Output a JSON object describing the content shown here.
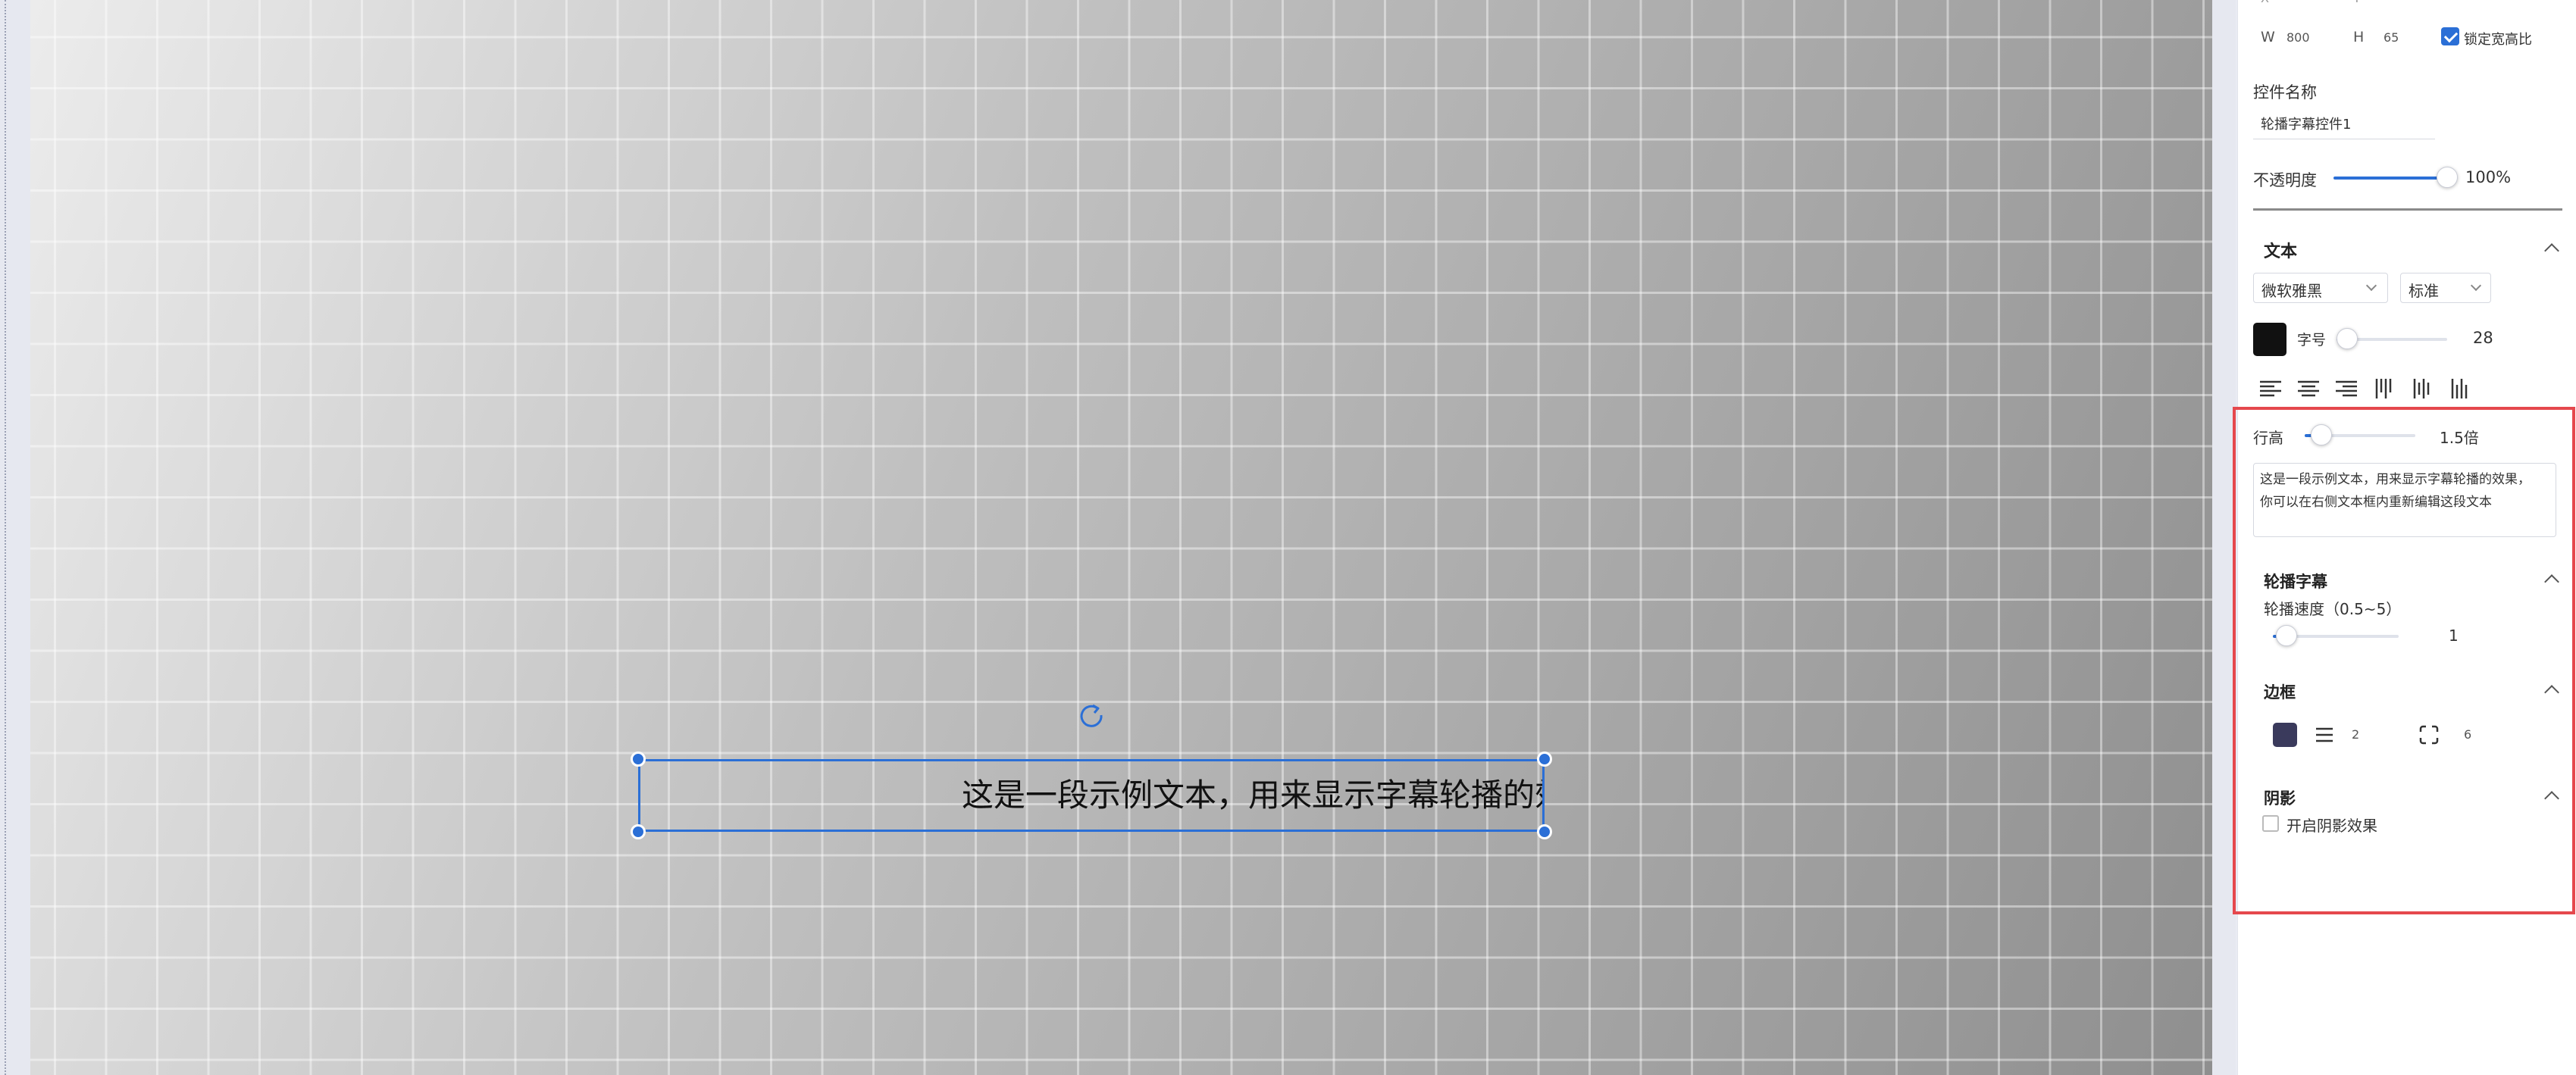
{
  "canvas": {
    "marquee_text": "这是一段示例文本，用来显示字幕轮播的效果，你可以在右侧文本框内重新编辑这段文本"
  },
  "panel": {
    "position": {
      "w_label": "W",
      "w_value": "800",
      "h_label": "H",
      "h_value": "65",
      "lock_ratio_label": "锁定宽高比",
      "lock_ratio_checked": true
    },
    "widget_name": {
      "label": "控件名称",
      "value": "轮播字幕控件1"
    },
    "opacity": {
      "label": "不透明度",
      "value": "100%",
      "level": 1.0
    },
    "text": {
      "title": "文本",
      "font_family": "微软雅黑",
      "font_weight": "标准",
      "color": "#111111",
      "font_size_label": "字号",
      "font_size_value": "28",
      "font_size_level": 0.06,
      "line_height_label": "行高",
      "line_height_value": "1.5倍",
      "line_height_level": 0.1,
      "content_line1": "这是一段示例文本，用来显示字幕轮播的效果，",
      "content_line2": "你可以在右侧文本框内重新编辑这段文本"
    },
    "marquee": {
      "title": "轮播字幕",
      "speed_label": "轮播速度（0.5~5）",
      "speed_value": "1",
      "speed_level": 0.11
    },
    "border": {
      "title": "边框",
      "color": "#3a3a5c",
      "width_value": "2",
      "radius_value": "6"
    },
    "shadow": {
      "title": "阴影",
      "enable_label": "开启阴影效果",
      "enabled": false
    }
  },
  "colors": {
    "accent": "#2b6fd6",
    "highlight": "#e5484d"
  }
}
